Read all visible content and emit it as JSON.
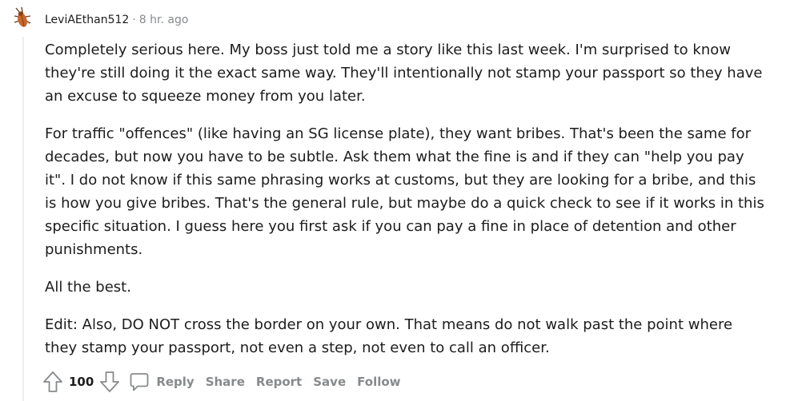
{
  "comment": {
    "author": "LeviAEthan512",
    "separator": "·",
    "time": "8 hr. ago",
    "paragraphs": [
      "Completely serious here. My boss just told me a story like this last week. I'm surprised to know they're still doing it the exact same way. They'll intentionally not stamp your passport so they have an excuse to squeeze money from you later.",
      "For traffic \"offences\" (like having an SG license plate), they want bribes. That's been the same for decades, but now you have to be subtle. Ask them what the fine is and if they can \"help you pay it\". I do not know if this same phrasing works at customs, but they are looking for a bribe, and this is how you give bribes. That's the general rule, but maybe do a quick check to see if it works in this specific situation. I guess here you first ask if you can pay a fine in place of detention and other punishments.",
      "All the best.",
      "Edit: Also, DO NOT cross the border on your own. That means do not walk past the point where they stamp your passport, not even a step, not even to call an officer."
    ],
    "score": "100"
  },
  "actions": {
    "reply": "Reply",
    "share": "Share",
    "report": "Report",
    "save": "Save",
    "follow": "Follow"
  },
  "icons": {
    "avatar": "cockroach-avatar-icon",
    "upvote": "upvote-arrow-icon",
    "downvote": "downvote-arrow-icon",
    "reply": "comment-bubble-icon"
  },
  "colors": {
    "text": "#1c1c1c",
    "meta": "#878a8c",
    "avatar": "#c9662a"
  }
}
